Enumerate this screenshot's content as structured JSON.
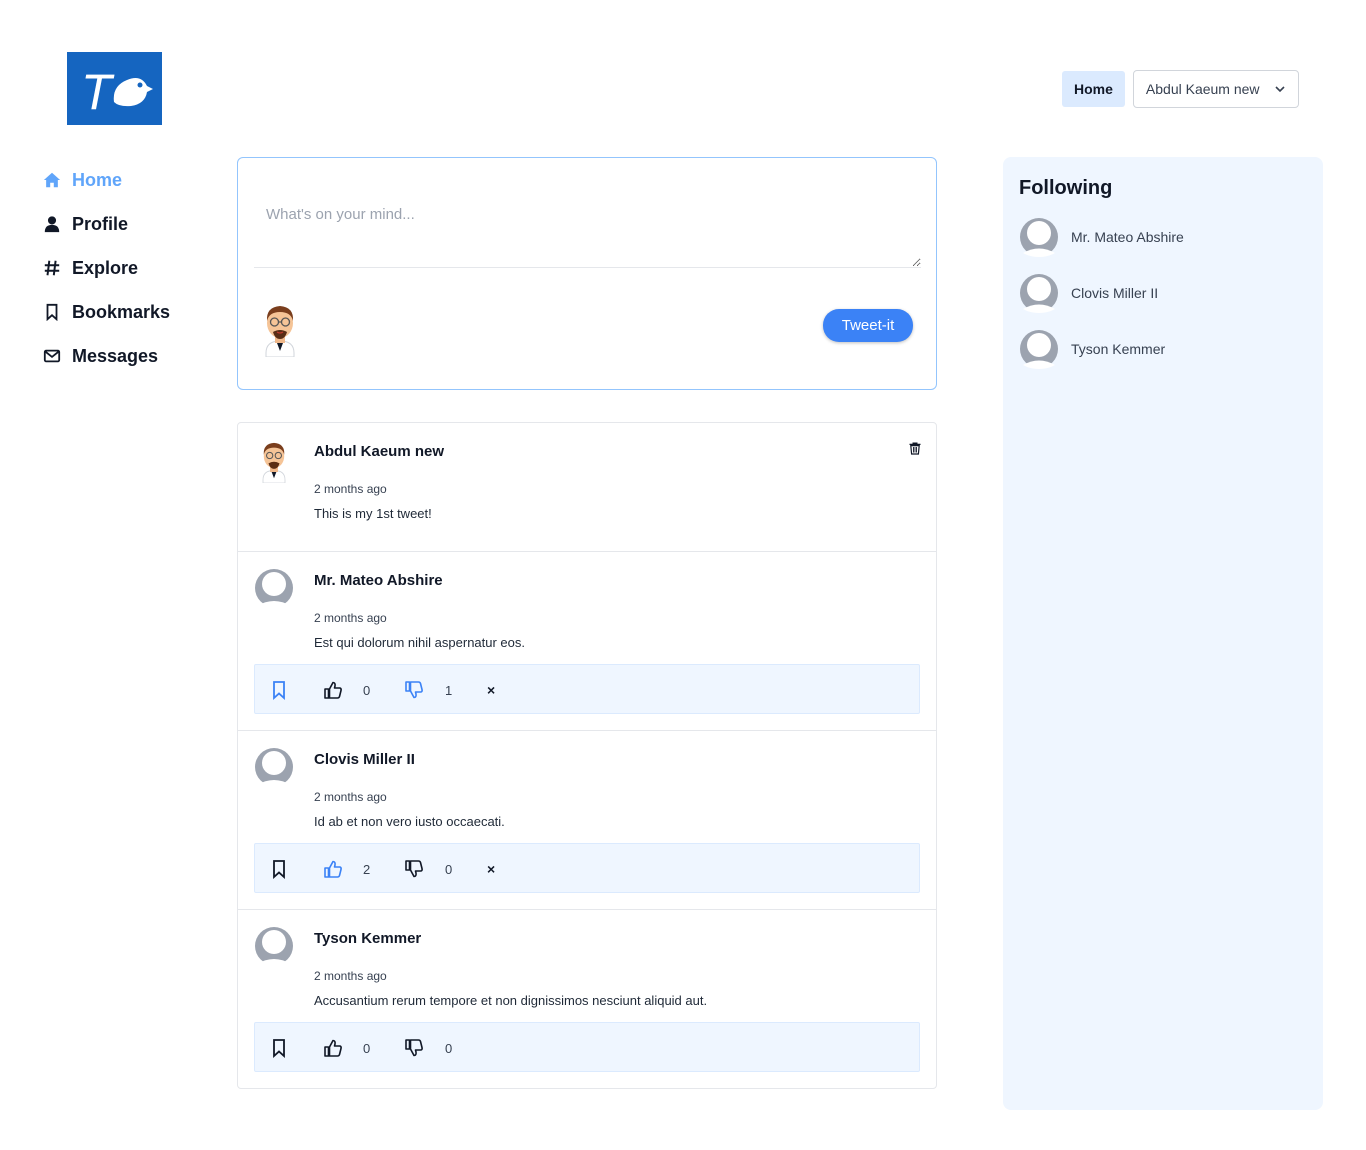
{
  "header": {
    "logo_letter": "T",
    "home_label": "Home",
    "user_menu_label": "Abdul Kaeum new"
  },
  "sidebar": {
    "items": [
      {
        "label": "Home",
        "icon": "home-icon",
        "active": true
      },
      {
        "label": "Profile",
        "icon": "user-icon",
        "active": false
      },
      {
        "label": "Explore",
        "icon": "hashtag-icon",
        "active": false
      },
      {
        "label": "Bookmarks",
        "icon": "bookmark-icon",
        "active": false
      },
      {
        "label": "Messages",
        "icon": "envelope-icon",
        "active": false
      }
    ]
  },
  "composer": {
    "placeholder": "What's on your mind...",
    "button_label": "Tweet-it"
  },
  "feed": {
    "tweets": [
      {
        "author": "Abdul Kaeum new",
        "time": "2 months ago",
        "text": "This is my 1st tweet!",
        "own": true
      },
      {
        "author": "Mr. Mateo Abshire",
        "time": "2 months ago",
        "text": "Est qui dolorum nihil aspernatur eos.",
        "likes": "0",
        "dislikes": "1",
        "bookmarked": true,
        "liked": false,
        "disliked": true,
        "close": "×"
      },
      {
        "author": "Clovis Miller II",
        "time": "2 months ago",
        "text": "Id ab et non vero iusto occaecati.",
        "likes": "2",
        "dislikes": "0",
        "bookmarked": false,
        "liked": true,
        "disliked": false,
        "close": "×"
      },
      {
        "author": "Tyson Kemmer",
        "time": "2 months ago",
        "text": "Accusantium rerum tempore et non dignissimos nesciunt aliquid aut.",
        "likes": "0",
        "dislikes": "0",
        "bookmarked": false,
        "liked": false,
        "disliked": false
      }
    ]
  },
  "following": {
    "title": "Following",
    "users": [
      "Mr. Mateo Abshire",
      "Clovis Miller II",
      "Tyson Kemmer"
    ]
  },
  "colors": {
    "brand": "#1565c0",
    "accent": "#3b82f6",
    "active_nav": "#60a5fa",
    "panel_bg": "#eff6ff"
  }
}
